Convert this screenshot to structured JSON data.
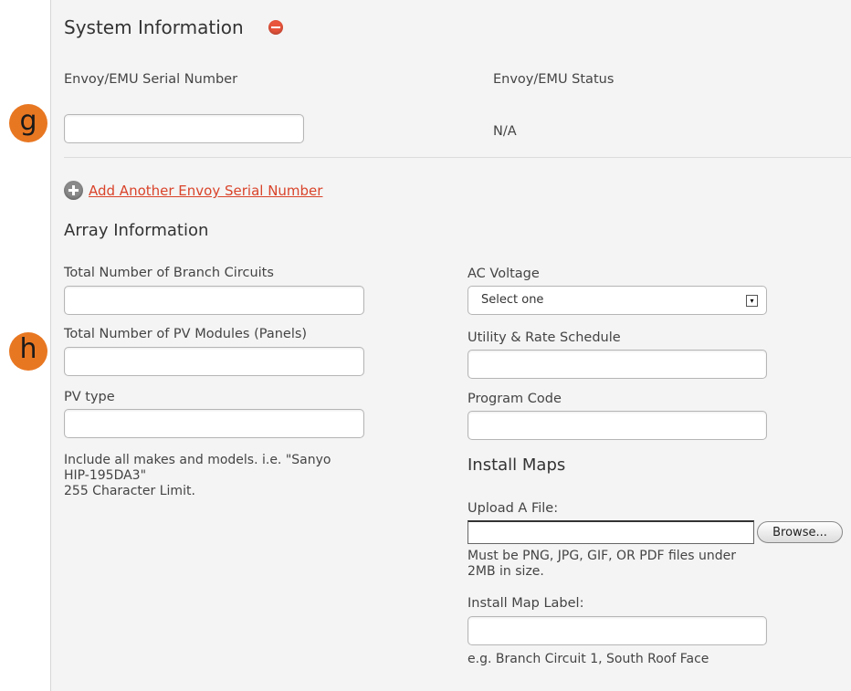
{
  "system_info": {
    "title": "System Information",
    "serial_label": "Envoy/EMU Serial Number",
    "status_label": "Envoy/EMU Status",
    "serial_value": "",
    "status_value": "N/A",
    "add_serial_link": "Add Another Envoy Serial Number"
  },
  "markers": {
    "g": "g",
    "h": "h"
  },
  "array_info": {
    "title": "Array Information",
    "branch_circuits_label": "Total Number of Branch Circuits",
    "pv_modules_label": "Total Number of PV Modules (Panels)",
    "pv_type_label": "PV type",
    "pv_type_hint_line1": "Include all makes and models. i.e. \"Sanyo",
    "pv_type_hint_line2": "HIP-195DA3\"",
    "pv_type_hint_line3": "255 Character Limit.",
    "ac_voltage_label": "AC Voltage",
    "ac_voltage_selected": "Select one",
    "utility_label": "Utility & Rate Schedule",
    "program_code_label": "Program Code"
  },
  "install_maps": {
    "title": "Install Maps",
    "upload_label": "Upload A File:",
    "browse_label": "Browse...",
    "upload_hint_line1": "Must be PNG, JPG, GIF, OR PDF files under",
    "upload_hint_line2": "2MB in size.",
    "map_label_label": "Install Map Label:",
    "map_label_hint": "e.g. Branch Circuit 1, South Roof Face"
  },
  "colors": {
    "accent_link": "#d9442b",
    "marker": "#e87722",
    "panel_bg": "#f4f4f4"
  }
}
